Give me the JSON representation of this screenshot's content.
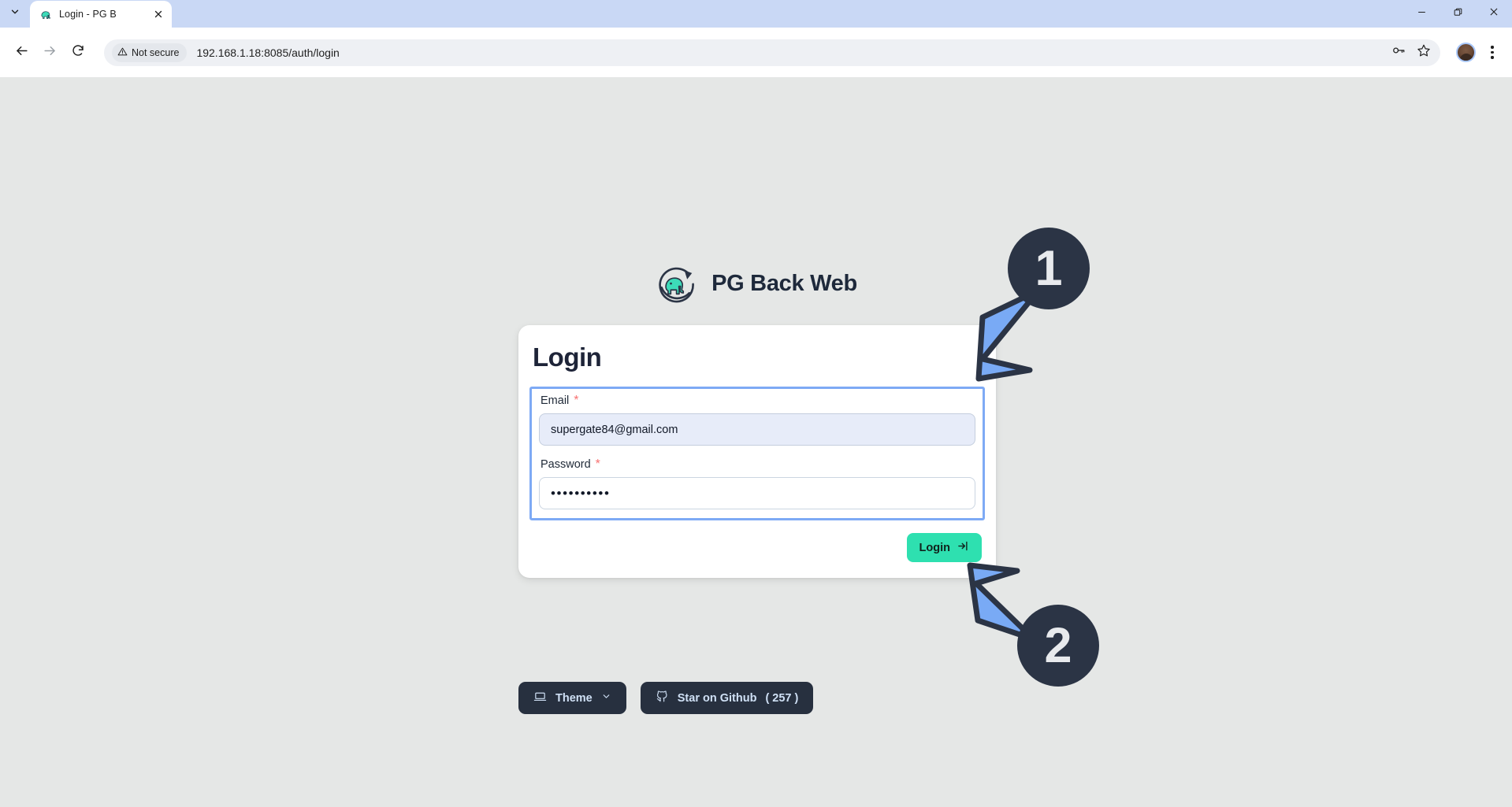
{
  "browser": {
    "tab": {
      "title": "Login - PG B",
      "favicon_icon": "elephant-favicon",
      "close_icon": "close-icon",
      "tab_list_icon": "chevron-down-icon"
    },
    "window_controls": {
      "minimize_icon": "minimize-icon",
      "maximize_icon": "restore-icon",
      "close_icon": "close-icon"
    },
    "toolbar": {
      "back_icon": "back-arrow-icon",
      "forward_icon": "forward-arrow-icon",
      "reload_icon": "reload-icon",
      "security_label": "Not secure",
      "security_icon": "warning-triangle-icon",
      "url": "192.168.1.18:8085/auth/login",
      "save_password_icon": "key-icon",
      "bookmark_icon": "star-icon",
      "profile_icon": "avatar",
      "menu_icon": "kebab-menu-icon"
    }
  },
  "page": {
    "background_color": "#e5e7e6",
    "brand": {
      "logo_icon": "elephant-refresh-logo",
      "name": "PG Back Web"
    },
    "login_card": {
      "title": "Login",
      "email": {
        "label": "Email",
        "required_marker": "*",
        "value": "supergate84@gmail.com",
        "placeholder": "Email"
      },
      "password": {
        "label": "Password",
        "required_marker": "*",
        "value": "••••••••••",
        "placeholder": "Password"
      },
      "submit": {
        "label": "Login",
        "icon": "login-arrow-icon",
        "color": "#2ee0b0"
      }
    },
    "footer": {
      "theme_button": {
        "label": "Theme",
        "icon": "laptop-icon",
        "chevron_icon": "chevron-down-icon"
      },
      "github_button": {
        "label": "Star on Github",
        "count": "( 257 )",
        "icon": "github-icon"
      }
    }
  },
  "annotations": {
    "badges": [
      {
        "number": "1",
        "color": "#2b3445"
      },
      {
        "number": "2",
        "color": "#2b3445"
      }
    ],
    "arrow_color": "#79aaf5"
  }
}
